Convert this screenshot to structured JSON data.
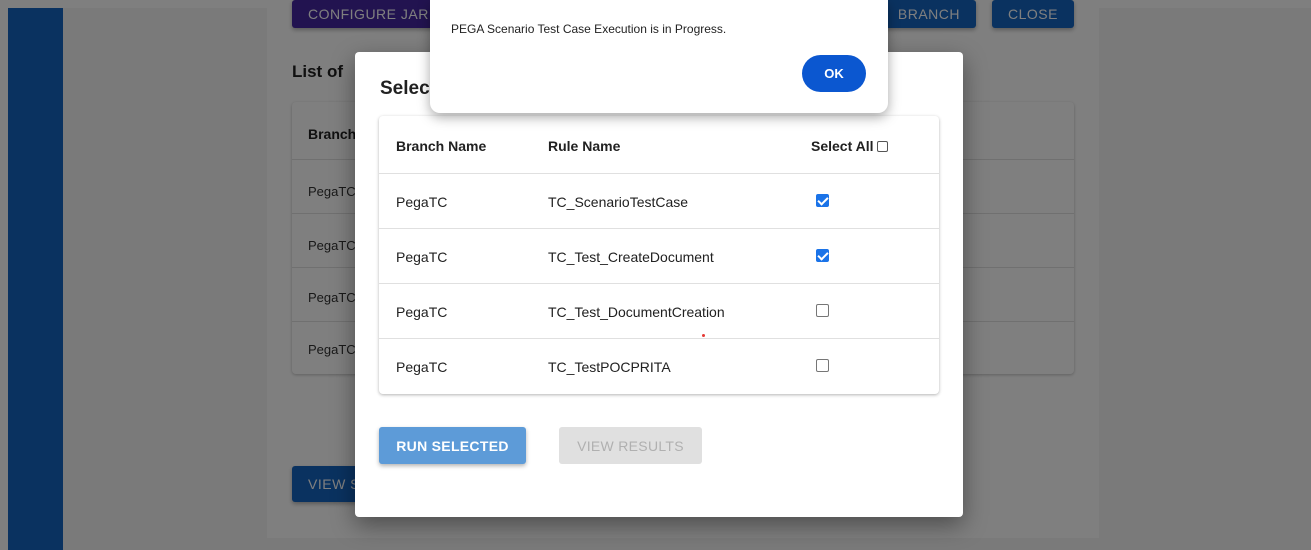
{
  "background": {
    "configure_label": "CONFIGURE JAR",
    "branch_label": "BRANCH",
    "close_label": "CLOSE",
    "list_title": "List of",
    "table_header": "Branch",
    "rows": [
      "PegaTC",
      "PegaTC",
      "PegaTC",
      "PegaTC"
    ],
    "view_label": "VIEW S"
  },
  "dialog": {
    "title": "Selec",
    "headers": {
      "branch": "Branch Name",
      "rule": "Rule Name",
      "select_all": "Select All"
    },
    "rows": [
      {
        "branch": "PegaTC",
        "rule": "TC_ScenarioTestCase",
        "checked": true
      },
      {
        "branch": "PegaTC",
        "rule": "TC_Test_CreateDocument",
        "checked": true
      },
      {
        "branch": "PegaTC",
        "rule": "TC_Test_DocumentCreation",
        "checked": false
      },
      {
        "branch": "PegaTC",
        "rule": "TC_TestPOCPRITA",
        "checked": false
      }
    ],
    "run_selected_label": "RUN SELECTED",
    "view_results_label": "VIEW RESULTS"
  },
  "alert": {
    "message": "PEGA Scenario Test Case Execution is in Progress.",
    "ok_label": "OK"
  },
  "colors": {
    "sidebar": "#1565c0",
    "primary_button": "#5d9bd8",
    "ok_button": "#0b57d0",
    "checkbox_checked": "#1a73e8"
  }
}
